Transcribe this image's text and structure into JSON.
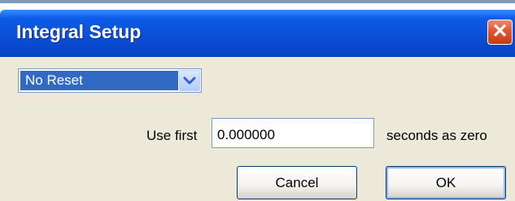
{
  "window": {
    "title": "Integral Setup",
    "close_symbol": "✕"
  },
  "reset_select": {
    "value": "No Reset",
    "icon": "chevron-down-icon"
  },
  "zero_offset": {
    "prefix_label": "Use first",
    "value": "0.000000",
    "suffix_label": "seconds as zero"
  },
  "buttons": {
    "cancel": "Cancel",
    "ok": "OK"
  },
  "colors": {
    "titlebar": "#0a4fd6",
    "close": "#e2552f",
    "selection": "#316ac5",
    "dialog_bg": "#ece9d8"
  }
}
